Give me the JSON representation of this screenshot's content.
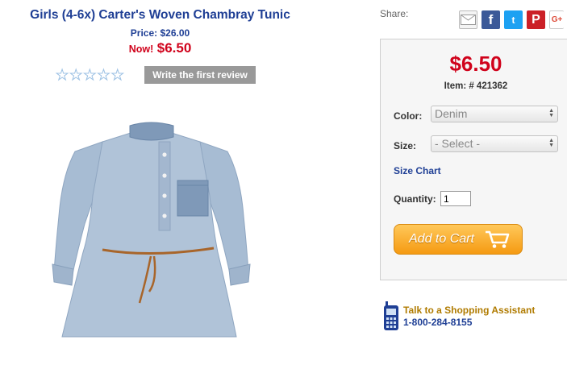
{
  "product": {
    "title": "Girls (4-6x) Carter's Woven Chambray Tunic",
    "price_line": "Price: $26.00",
    "now_label": "Now!",
    "now_price": "$6.50",
    "rating_stars": 0,
    "review_button": "Write the first review"
  },
  "share": {
    "label": "Share:",
    "icons": [
      "email-icon",
      "facebook-icon",
      "twitter-icon",
      "pinterest-icon",
      "google-plus-icon"
    ],
    "fb_glyph": "f",
    "tw_glyph": "t",
    "pin_glyph": "P",
    "gp_glyph": "G+"
  },
  "panel": {
    "price": "$6.50",
    "item_number": "Item: # 421362",
    "color_label": "Color:",
    "color_value": "Denim",
    "size_label": "Size:",
    "size_value": "- Select -",
    "size_chart": "Size Chart",
    "quantity_label": "Quantity:",
    "quantity_value": "1",
    "add_to_cart": "Add to Cart"
  },
  "assistant": {
    "label": "Talk to a Shopping Assistant",
    "phone": "1-800-284-8155"
  },
  "colors": {
    "title_blue": "#1f3f95",
    "sale_red": "#d0021b",
    "cart_orange": "#f59a12",
    "denim": "#a9bed6"
  }
}
